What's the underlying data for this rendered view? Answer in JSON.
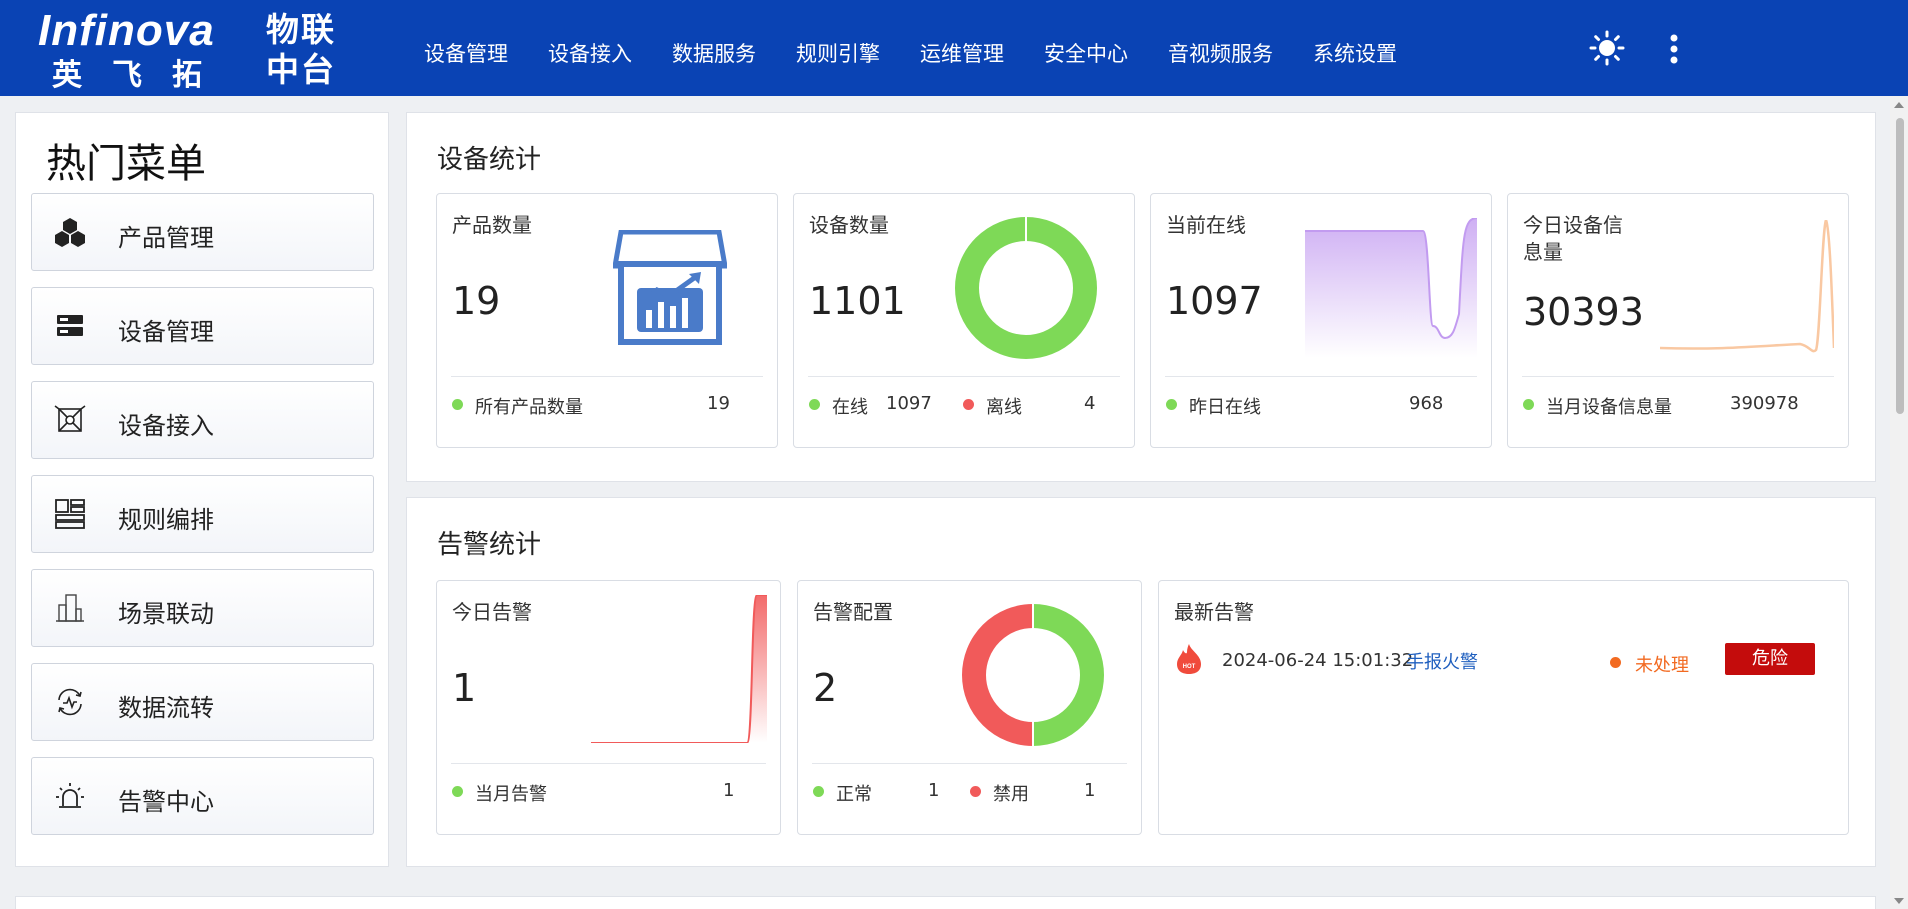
{
  "header": {
    "brand": "Infinova",
    "brand_cn": "英飞拓",
    "platform": "物联中台",
    "nav": [
      "设备管理",
      "设备接入",
      "数据服务",
      "规则引擎",
      "运维管理",
      "安全中心",
      "音视频服务",
      "系统设置"
    ],
    "icons": [
      "sun-icon",
      "more-vertical-icon"
    ]
  },
  "sidebar": {
    "title": "热门菜单",
    "items": [
      {
        "label": "产品管理",
        "icon": "cubes-icon"
      },
      {
        "label": "设备管理",
        "icon": "server-icon"
      },
      {
        "label": "设备接入",
        "icon": "device-access-icon"
      },
      {
        "label": "规则编排",
        "icon": "layout-icon"
      },
      {
        "label": "场景联动",
        "icon": "building-icon"
      },
      {
        "label": "数据流转",
        "icon": "data-flow-icon"
      },
      {
        "label": "告警中心",
        "icon": "alarm-light-icon"
      }
    ]
  },
  "device_stats": {
    "title": "设备统计",
    "product": {
      "title": "产品数量",
      "value": "19",
      "legend": "所有产品数量",
      "legend_value": "19"
    },
    "device": {
      "title": "设备数量",
      "value": "1101",
      "online_label": "在线",
      "online": "1097",
      "offline_label": "离线",
      "offline": "4"
    },
    "current_online": {
      "title": "当前在线",
      "value": "1097",
      "legend": "昨日在线",
      "legend_value": "968"
    },
    "today_msg": {
      "title_line1": "今日设备信",
      "title_line2": "息量",
      "value": "30393",
      "legend": "当月设备信息量",
      "legend_value": "390978"
    }
  },
  "alarm_stats": {
    "title": "告警统计",
    "today": {
      "title": "今日告警",
      "value": "1",
      "legend": "当月告警",
      "legend_value": "1"
    },
    "config": {
      "title": "告警配置",
      "value": "2",
      "normal_label": "正常",
      "normal": "1",
      "disabled_label": "禁用",
      "disabled": "1"
    },
    "latest": {
      "title": "最新告警",
      "rows": [
        {
          "icon": "hot-fire-icon",
          "time": "2024-06-24 15:01:32",
          "name": "手报火警",
          "status": "未处理",
          "level": "危险"
        }
      ]
    }
  },
  "colors": {
    "header_bg": "#0a43b4",
    "online_green": "#7ed957",
    "offline_red": "#f15a5a",
    "danger": "#c40c0c",
    "pending_orange": "#f26a21",
    "link_blue": "#1f5fbf"
  }
}
